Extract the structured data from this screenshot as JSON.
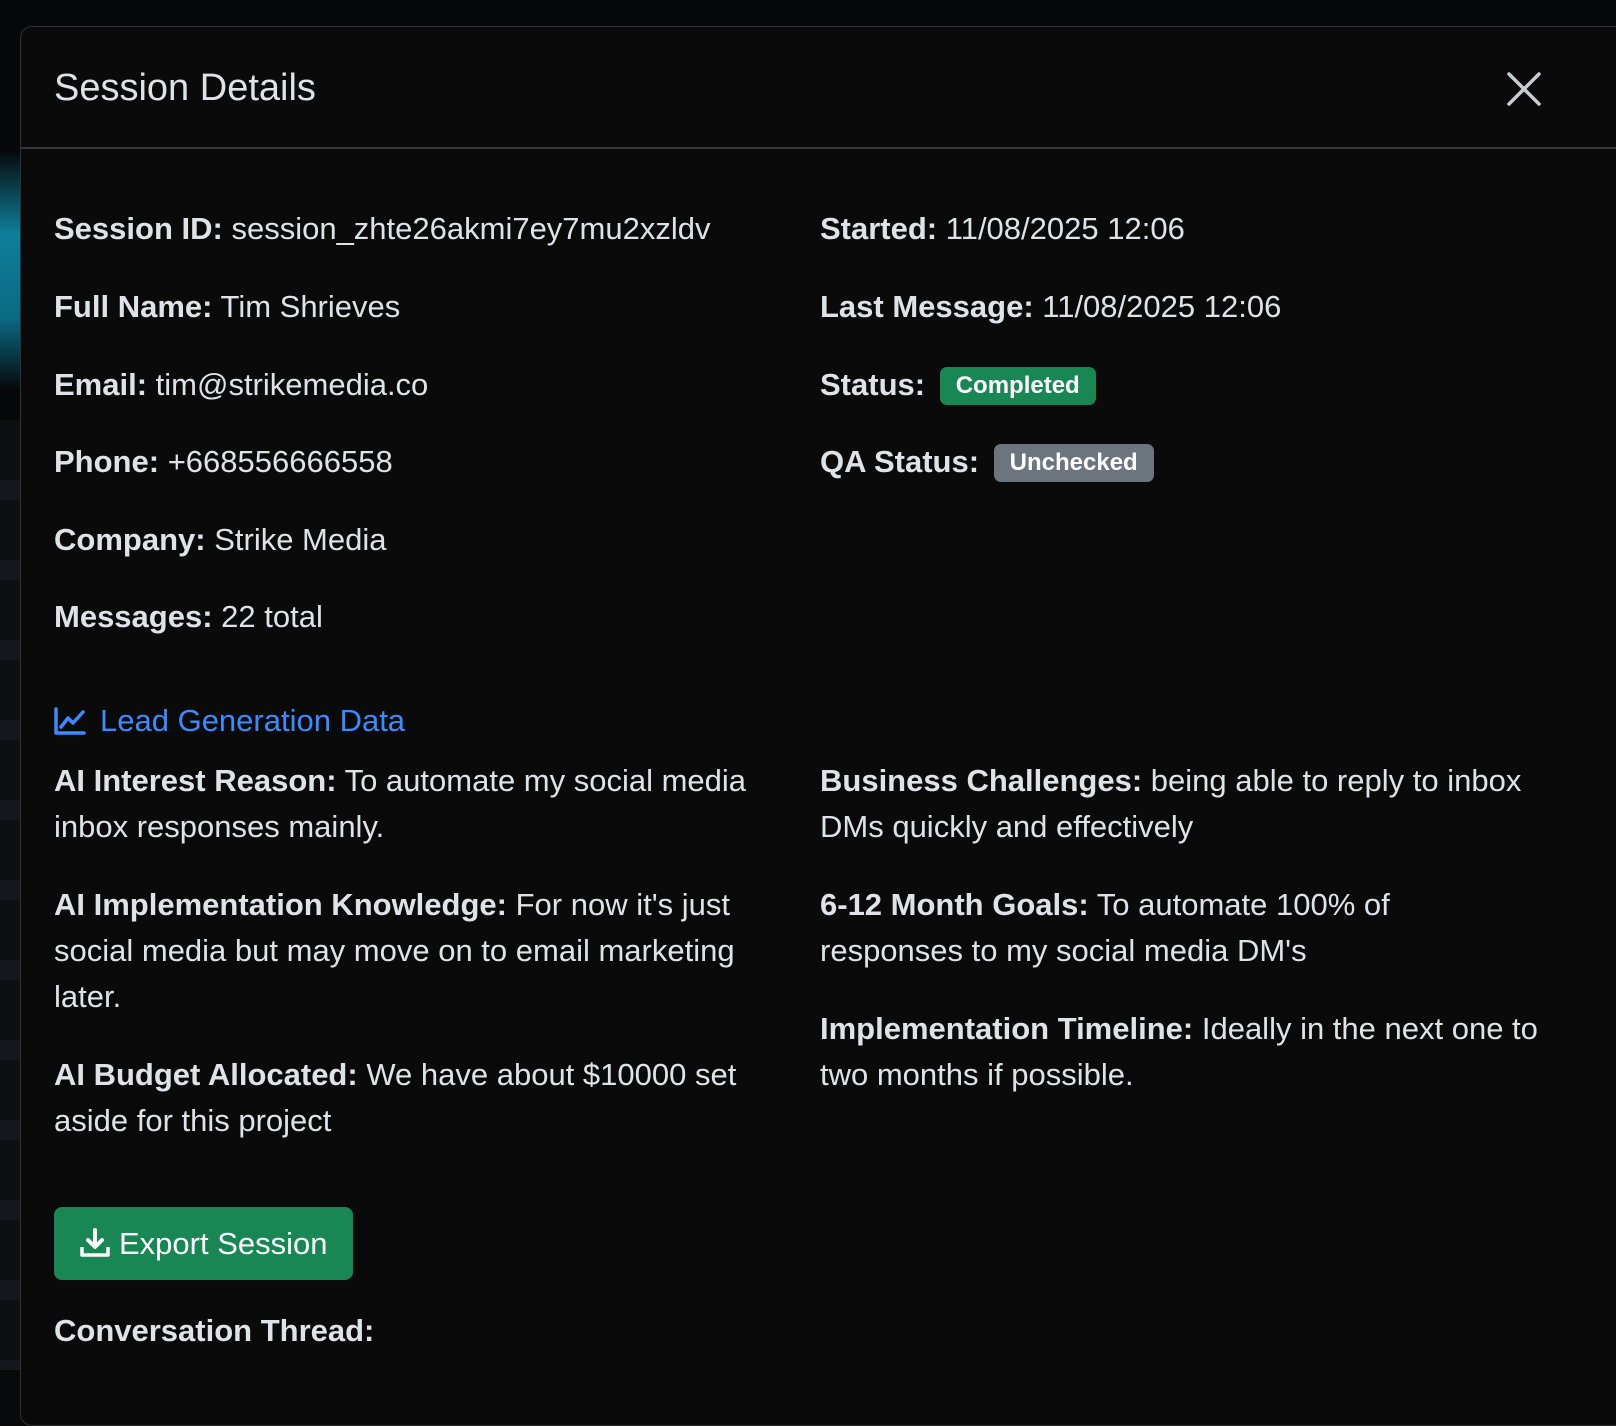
{
  "modal": {
    "title": "Session Details"
  },
  "info_left": [
    {
      "label": "Session ID:",
      "value": "session_zhte26akmi7ey7mu2xzldv"
    },
    {
      "label": "Full Name:",
      "value": "Tim Shrieves"
    },
    {
      "label": "Email:",
      "value": "tim@strikemedia.co"
    },
    {
      "label": "Phone:",
      "value": "+668556666558"
    },
    {
      "label": "Company:",
      "value": "Strike Media"
    },
    {
      "label": "Messages:",
      "value": "22 total"
    }
  ],
  "info_right": {
    "started": {
      "label": "Started:",
      "value": "11/08/2025 12:06"
    },
    "last_message": {
      "label": "Last Message:",
      "value": "11/08/2025 12:06"
    },
    "status": {
      "label": "Status:",
      "value": "Completed",
      "color": "#198754"
    },
    "qa_status": {
      "label": "QA Status:",
      "value": "Unchecked",
      "color": "#6c757d"
    }
  },
  "lead": {
    "heading": "Lead Generation Data",
    "icon": "line-chart-icon",
    "accent": "#3b8bff",
    "left": [
      {
        "label": "AI Interest Reason:",
        "value": "To automate my social media inbox responses mainly."
      },
      {
        "label": "AI Implementation Knowledge:",
        "value": "For now it's just social media but may move on to email marketing later."
      },
      {
        "label": "AI Budget Allocated:",
        "value": "We have about $10000 set aside for this project"
      }
    ],
    "right": [
      {
        "label": "Business Challenges:",
        "value": "being able to reply to inbox DMs quickly and effectively"
      },
      {
        "label": "6-12 Month Goals:",
        "value": "To automate 100% of responses to my social media DM's"
      },
      {
        "label": "Implementation Timeline:",
        "value": "Ideally in the next one to two months if possible."
      }
    ]
  },
  "actions": {
    "export_label": "Export Session",
    "export_icon": "download-icon",
    "export_color": "#198754"
  },
  "thread": {
    "label": "Conversation Thread:"
  }
}
